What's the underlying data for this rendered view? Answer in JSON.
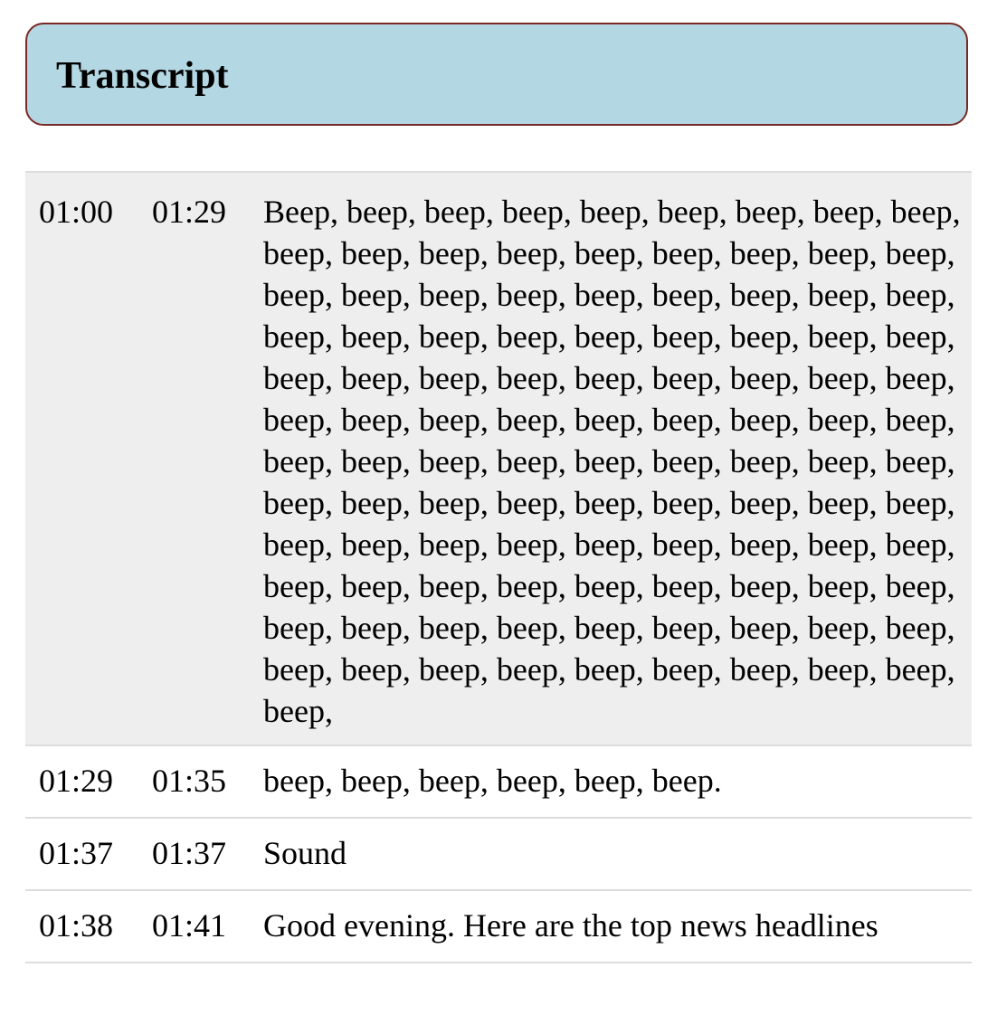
{
  "panel": {
    "title": "Transcript"
  },
  "transcript": {
    "rows": [
      {
        "start": "01:00",
        "end": "01:29",
        "text": "Beep, beep, beep, beep, beep, beep, beep, beep, beep, beep, beep, beep, beep, beep, beep, beep, beep, beep, beep, beep, beep, beep, beep, beep, beep, beep, beep, beep, beep, beep, beep, beep, beep, beep, beep, beep, beep, beep, beep, beep, beep, beep, beep, beep, beep, beep, beep, beep, beep, beep, beep, beep, beep, beep, beep, beep, beep, beep, beep, beep, beep, beep, beep, beep, beep, beep, beep, beep, beep, beep, beep, beep, beep, beep, beep, beep, beep, beep, beep, beep, beep, beep, beep, beep, beep, beep, beep, beep, beep, beep, beep, beep, beep, beep, beep, beep, beep, beep, beep, beep, beep, beep, beep, beep, beep, beep, beep, beep, beep,"
      },
      {
        "start": "01:29",
        "end": "01:35",
        "text": "beep, beep, beep, beep, beep, beep."
      },
      {
        "start": "01:37",
        "end": "01:37",
        "text": "Sound"
      },
      {
        "start": "01:38",
        "end": "01:41",
        "text": "Good evening. Here are the top news headlines"
      }
    ]
  }
}
